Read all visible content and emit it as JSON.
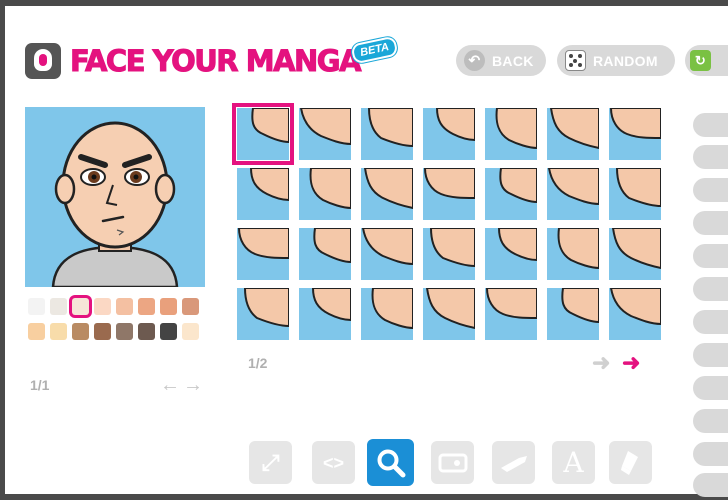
{
  "app": {
    "logo_text": "FACE YOUR MANGA",
    "beta_label": "BETA"
  },
  "header": {
    "back_label": "BACK",
    "random_label": "RANDOM"
  },
  "left_panel": {
    "page_indicator": "1/1",
    "skin_swatches": [
      "#f3f3f3",
      "#ece8e2",
      "#f6e6d8",
      "#fbd8c4",
      "#f4c0a2",
      "#eca683",
      "#e9a07c",
      "#d9987a",
      "#f8cfa0",
      "#f8dcaa",
      "#b98b63",
      "#9a6a4e",
      "#8f7768",
      "#6d5a50",
      "#444444",
      "#fbe6cc"
    ],
    "selected_swatch": "#f6e6d8"
  },
  "grid": {
    "page_indicator": "1/2",
    "selected_tile": "0"
  },
  "toolbar": {
    "items": [
      "resize-icon",
      "code-arrows-icon",
      "search-icon",
      "face-shape-icon",
      "brush-icon",
      "text-icon",
      "eraser-icon"
    ],
    "active": "search-icon",
    "text_tool_glyph": "A"
  },
  "colors": {
    "brand": "#e4127f",
    "accent_blue": "#1b8fd6",
    "skin": "#f4c8a9",
    "background_blue": "#7fc6ea"
  }
}
